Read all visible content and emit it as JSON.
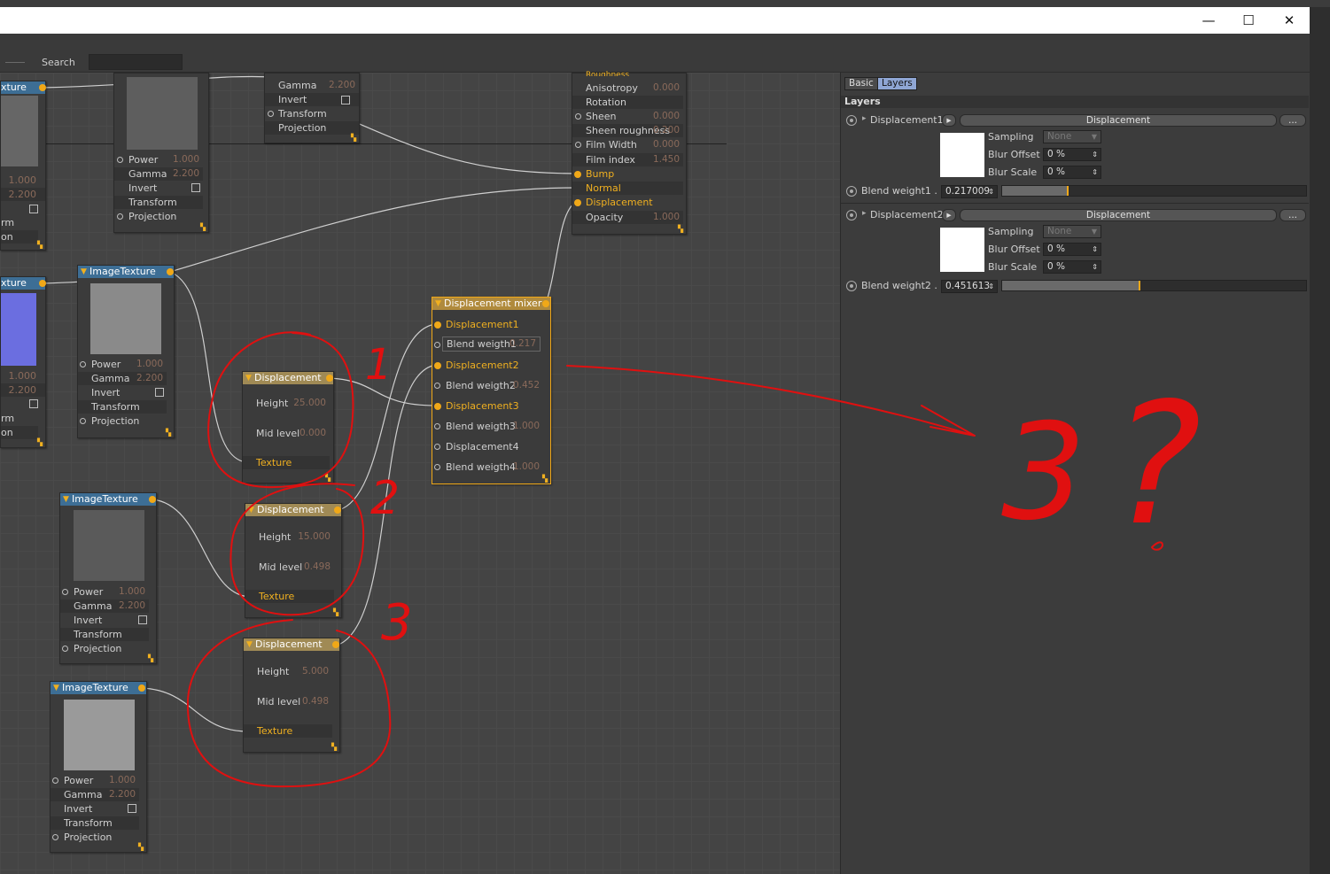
{
  "toolbar": {
    "search_label": "Search",
    "search_value": ""
  },
  "window_controls": {
    "minimize": "—",
    "maximize": "☐",
    "close": "✕"
  },
  "nodes": {
    "partial_top": {
      "gamma": "Gamma",
      "gamma_val": "2.200",
      "invert": "Invert",
      "transform": "Transform",
      "projection": "Projection"
    },
    "tex_top_left": {
      "title": "xture",
      "v1": "1.000",
      "v2": "2.200",
      "rm": "rm",
      "on": "on"
    },
    "tex_a": {
      "power": "Power",
      "power_val": "1.000",
      "gamma": "Gamma",
      "gamma_val": "2.200",
      "invert": "Invert",
      "transform": "Transform",
      "projection": "Projection"
    },
    "material": {
      "roughness": "Roughness",
      "anisotropy": "Anisotropy",
      "anisotropy_val": "0.000",
      "rotation": "Rotation",
      "sheen": "Sheen",
      "sheen_val": "0.000",
      "sheen_roughness": "Sheen roughness",
      "sheen_roughness_val": "0.200",
      "film_width": "Film Width",
      "film_width_val": "0.000",
      "film_index": "Film index",
      "film_index_val": "1.450",
      "bump": "Bump",
      "normal": "Normal",
      "displacement": "Displacement",
      "opacity": "Opacity",
      "opacity_val": "1.000"
    },
    "tex_mid_left": {
      "title": "xture",
      "v1": "1.000",
      "v2": "2.200",
      "rm": "rm",
      "on": "on"
    },
    "tex_b": {
      "title": "ImageTexture",
      "power": "Power",
      "power_val": "1.000",
      "gamma": "Gamma",
      "gamma_val": "2.200",
      "invert": "Invert",
      "transform": "Transform",
      "projection": "Projection"
    },
    "disp1": {
      "title": "Displacement",
      "height": "Height",
      "height_val": "25.000",
      "mid": "Mid level",
      "mid_val": "0.000",
      "texture": "Texture"
    },
    "disp2": {
      "title": "Displacement",
      "height": "Height",
      "height_val": "15.000",
      "mid": "Mid level",
      "mid_val": "0.498",
      "texture": "Texture"
    },
    "disp3": {
      "title": "Displacement",
      "height": "Height",
      "height_val": "5.000",
      "mid": "Mid level",
      "mid_val": "0.498",
      "texture": "Texture"
    },
    "mixer": {
      "title": "Displacement mixer",
      "d1": "Displacement1",
      "bw1": "Blend weigth1",
      "bw1_val": "0.217",
      "d2": "Displacement2",
      "bw2": "Blend weigth2",
      "bw2_val": "0.452",
      "d3": "Displacement3",
      "bw3": "Blend weigth3",
      "bw3_val": "1.000",
      "d4": "Displacement4",
      "bw4": "Blend weigth4",
      "bw4_val": "1.000"
    },
    "tex_c": {
      "title": "ImageTexture",
      "power": "Power",
      "power_val": "1.000",
      "gamma": "Gamma",
      "gamma_val": "2.200",
      "invert": "Invert",
      "transform": "Transform",
      "projection": "Projection"
    },
    "tex_d": {
      "title": "ImageTexture",
      "power": "Power",
      "power_val": "1.000",
      "gamma": "Gamma",
      "gamma_val": "2.200",
      "invert": "Invert",
      "transform": "Transform",
      "projection": "Projection"
    }
  },
  "panel": {
    "tabs": [
      "Basic",
      "Layers"
    ],
    "active_tab": "Layers",
    "section": "Layers",
    "layers": [
      {
        "name": "Displacement1",
        "button": "Displacement",
        "more": "...",
        "sampling_label": "Sampling",
        "sampling_val": "None",
        "blur_offset_label": "Blur Offset",
        "blur_offset_val": "0 %",
        "blur_scale_label": "Blur Scale",
        "blur_scale_val": "0 %",
        "blend_label": "Blend weight1 . .",
        "blend_val": "0.217009",
        "blend_fraction": 0.217
      },
      {
        "name": "Displacement2",
        "button": "Displacement",
        "more": "...",
        "sampling_label": "Sampling",
        "sampling_val": "None",
        "blur_offset_label": "Blur Offset",
        "blur_offset_val": "0 %",
        "blur_scale_label": "Blur Scale",
        "blur_scale_val": "0 %",
        "blend_label": "Blend weight2 . .",
        "blend_val": "0.451613",
        "blend_fraction": 0.452
      }
    ]
  },
  "colors": {
    "accent": "#f0a818",
    "annotation": "#e01010",
    "node_blue": "#3d6e95",
    "node_gold": "#a08a55"
  },
  "annotations": [
    "1",
    "2",
    "3",
    "3",
    "?"
  ]
}
